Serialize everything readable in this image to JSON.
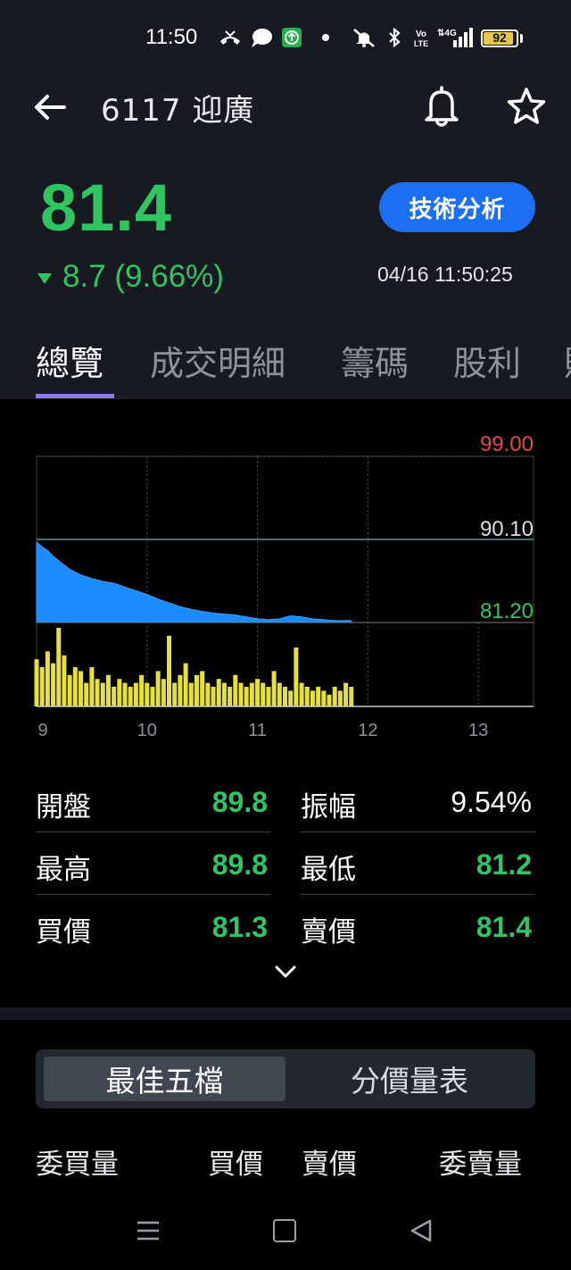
{
  "status_bar": {
    "time": "11:50",
    "battery": "92",
    "battery_level": 0.92,
    "network": "4G",
    "icons": [
      "missed-call-icon",
      "chat-bubble-icon",
      "upload-app-icon",
      "dot-icon",
      "mute-icon",
      "bluetooth-icon",
      "volte-icon",
      "signal-icon",
      "battery-icon"
    ]
  },
  "app_bar": {
    "title": "6117 迎廣",
    "back_icon": "arrow-left-icon",
    "alert_icon": "bell-icon",
    "favorite_icon": "star-icon"
  },
  "quote": {
    "price": "81.4",
    "change": "8.7 (9.66%)",
    "direction": "down",
    "timestamp": "04/16 11:50:25",
    "tech_button": "技術分析",
    "down_color": "#31c463",
    "up_color": "#e04a4a",
    "accent": "#1d6ff2"
  },
  "tabs": [
    {
      "label": "總覽",
      "active": true
    },
    {
      "label": "成交明細",
      "active": false
    },
    {
      "label": "籌碼",
      "active": false
    },
    {
      "label": "股利",
      "active": false
    },
    {
      "label": "財",
      "active": false
    }
  ],
  "chart_data": {
    "type": "area",
    "y_labels": {
      "high": "99.00",
      "ref": "90.10",
      "low": "81.20"
    },
    "ylim": [
      81.2,
      99.0
    ],
    "reference": 90.1,
    "x_ticks": [
      "9",
      "10",
      "11",
      "12",
      "13"
    ],
    "price_series": {
      "times": [
        9.0,
        9.05,
        9.1,
        9.15,
        9.2,
        9.3,
        9.4,
        9.5,
        9.6,
        9.7,
        9.8,
        9.9,
        10.0,
        10.1,
        10.2,
        10.3,
        10.4,
        10.5,
        10.6,
        10.7,
        10.8,
        10.9,
        11.0,
        11.1,
        11.2,
        11.3,
        11.4,
        11.5,
        11.6,
        11.7,
        11.8,
        11.85
      ],
      "values": [
        89.8,
        89.3,
        88.9,
        88.3,
        87.8,
        86.9,
        86.3,
        85.9,
        85.6,
        85.4,
        85.0,
        84.6,
        84.2,
        83.7,
        83.3,
        82.9,
        82.6,
        82.4,
        82.2,
        82.1,
        82.0,
        81.8,
        81.6,
        81.5,
        81.6,
        81.9,
        81.8,
        81.6,
        81.5,
        81.4,
        81.4,
        81.4
      ],
      "color": "#1a8cff"
    },
    "volume_series": {
      "times": [
        9.0,
        9.05,
        9.1,
        9.15,
        9.2,
        9.25,
        9.3,
        9.35,
        9.4,
        9.45,
        9.5,
        9.55,
        9.6,
        9.65,
        9.7,
        9.75,
        9.8,
        9.85,
        9.9,
        9.95,
        10.0,
        10.05,
        10.1,
        10.15,
        10.2,
        10.25,
        10.3,
        10.35,
        10.4,
        10.45,
        10.5,
        10.55,
        10.6,
        10.65,
        10.7,
        10.75,
        10.8,
        10.85,
        10.9,
        10.95,
        11.0,
        11.05,
        11.1,
        11.15,
        11.2,
        11.25,
        11.3,
        11.35,
        11.4,
        11.45,
        11.5,
        11.55,
        11.6,
        11.65,
        11.7,
        11.75,
        11.8,
        11.85
      ],
      "values": [
        0.6,
        0.5,
        0.7,
        0.55,
        1.0,
        0.65,
        0.4,
        0.5,
        0.45,
        0.3,
        0.5,
        0.35,
        0.3,
        0.4,
        0.25,
        0.35,
        0.3,
        0.25,
        0.3,
        0.4,
        0.3,
        0.25,
        0.45,
        0.35,
        0.9,
        0.3,
        0.4,
        0.55,
        0.3,
        0.4,
        0.45,
        0.3,
        0.25,
        0.35,
        0.3,
        0.25,
        0.4,
        0.3,
        0.25,
        0.3,
        0.35,
        0.3,
        0.25,
        0.45,
        0.3,
        0.25,
        0.2,
        0.75,
        0.3,
        0.25,
        0.2,
        0.25,
        0.2,
        0.15,
        0.25,
        0.2,
        0.3,
        0.25
      ],
      "color": "#e6e03a"
    },
    "high_color": "#e04a4a",
    "ref_color": "#d9dce1",
    "low_color": "#31c463"
  },
  "stats": {
    "rows": [
      {
        "left_label": "開盤",
        "left_value": "89.8",
        "right_label": "振幅",
        "right_value": "9.54%"
      },
      {
        "left_label": "最高",
        "left_value": "89.8",
        "right_label": "最低",
        "right_value": "81.2"
      },
      {
        "left_label": "買價",
        "left_value": "81.3",
        "right_label": "賣價",
        "right_value": "81.4"
      }
    ],
    "expand_icon": "chevron-down-icon"
  },
  "order_book": {
    "segments": [
      {
        "label": "最佳五檔",
        "active": true
      },
      {
        "label": "分價量表",
        "active": false
      }
    ],
    "headers": [
      "委買量",
      "買價",
      "賣價",
      "委賣量"
    ]
  },
  "nav_bar": {
    "icons": [
      "menu-icon",
      "home-square-icon",
      "back-triangle-icon"
    ]
  }
}
